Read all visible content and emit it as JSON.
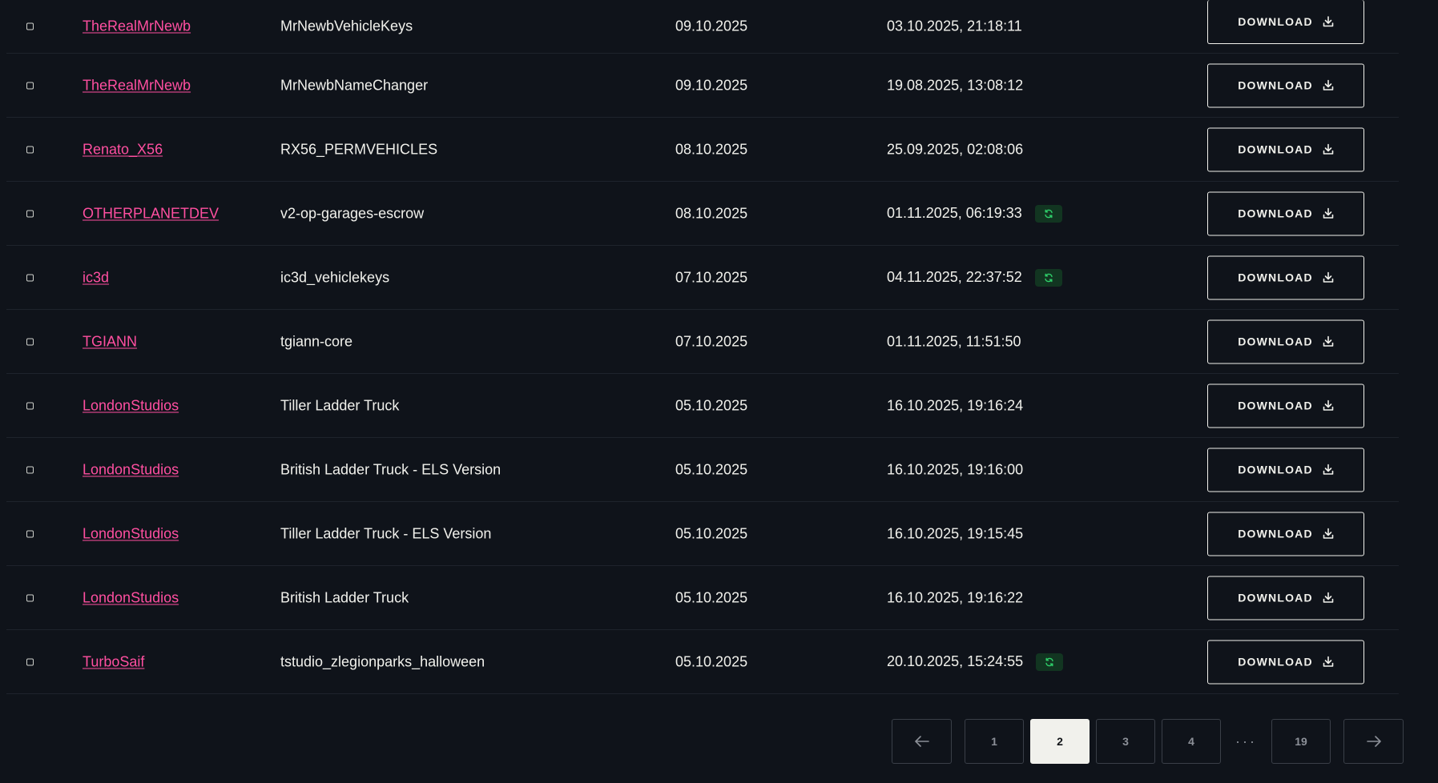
{
  "rows": [
    {
      "author": "TheRealMrNewb",
      "name": "MrNewbVehicleKeys",
      "date": "09.10.2025",
      "updated": "03.10.2025, 21:18:11",
      "synced": false,
      "action": "DOWNLOAD"
    },
    {
      "author": "TheRealMrNewb",
      "name": "MrNewbNameChanger",
      "date": "09.10.2025",
      "updated": "19.08.2025, 13:08:12",
      "synced": false,
      "action": "DOWNLOAD"
    },
    {
      "author": "Renato_X56",
      "name": "RX56_PERMVEHICLES",
      "date": "08.10.2025",
      "updated": "25.09.2025, 02:08:06",
      "synced": false,
      "action": "DOWNLOAD"
    },
    {
      "author": "OTHERPLANETDEV",
      "name": "v2-op-garages-escrow",
      "date": "08.10.2025",
      "updated": "01.11.2025, 06:19:33",
      "synced": true,
      "action": "DOWNLOAD"
    },
    {
      "author": "ic3d",
      "name": "ic3d_vehiclekeys",
      "date": "07.10.2025",
      "updated": "04.11.2025, 22:37:52",
      "synced": true,
      "action": "DOWNLOAD"
    },
    {
      "author": "TGIANN",
      "name": "tgiann-core",
      "date": "07.10.2025",
      "updated": "01.11.2025, 11:51:50",
      "synced": false,
      "action": "DOWNLOAD"
    },
    {
      "author": "LondonStudios",
      "name": "Tiller Ladder Truck",
      "date": "05.10.2025",
      "updated": "16.10.2025, 19:16:24",
      "synced": false,
      "action": "DOWNLOAD"
    },
    {
      "author": "LondonStudios",
      "name": "British Ladder Truck - ELS Version",
      "date": "05.10.2025",
      "updated": "16.10.2025, 19:16:00",
      "synced": false,
      "action": "DOWNLOAD"
    },
    {
      "author": "LondonStudios",
      "name": "Tiller Ladder Truck - ELS Version",
      "date": "05.10.2025",
      "updated": "16.10.2025, 19:15:45",
      "synced": false,
      "action": "DOWNLOAD"
    },
    {
      "author": "LondonStudios",
      "name": "British Ladder Truck",
      "date": "05.10.2025",
      "updated": "16.10.2025, 19:16:22",
      "synced": false,
      "action": "DOWNLOAD"
    },
    {
      "author": "TurboSaif",
      "name": "tstudio_zlegionparks_halloween",
      "date": "05.10.2025",
      "updated": "20.10.2025, 15:24:55",
      "synced": true,
      "action": "DOWNLOAD"
    }
  ],
  "pagination": {
    "prev_icon": "arrow-left-icon",
    "next_icon": "arrow-right-icon",
    "pages": [
      "1",
      "2",
      "3",
      "4"
    ],
    "current": "2",
    "ellipsis": "···",
    "last": "19"
  },
  "icons": {
    "download": "download-icon",
    "sync": "sync-icon",
    "checkbox": "checkbox"
  },
  "colors": {
    "background": "#0f131a",
    "author_link": "#ff4fa0",
    "sync_badge_bg": "#123521",
    "sync_icon": "#2fd06a",
    "active_page_bg": "#f1f1ec"
  }
}
